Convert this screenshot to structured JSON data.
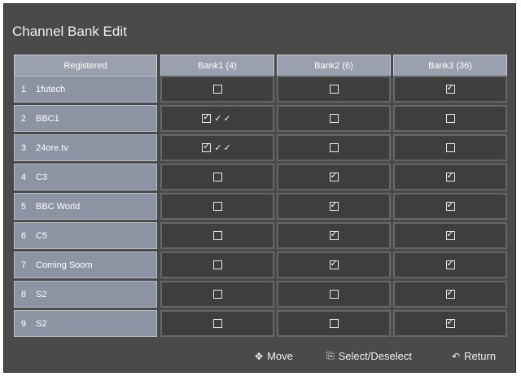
{
  "title": "Channel Bank Edit",
  "headers": {
    "registered": "Registered",
    "bank1": "Bank1 (4)",
    "bank2": "Bank2 (6)",
    "bank3": "Bank3 (36)"
  },
  "rows": [
    {
      "num": "1",
      "name": "1futech",
      "bank1": false,
      "bank2": false,
      "bank3": true,
      "marks": ""
    },
    {
      "num": "2",
      "name": "BBC1",
      "bank1": true,
      "bank2": false,
      "bank3": false,
      "marks": "✓✓"
    },
    {
      "num": "3",
      "name": "24ore.tv",
      "bank1": true,
      "bank2": false,
      "bank3": false,
      "marks": "✓✓"
    },
    {
      "num": "4",
      "name": "C3",
      "bank1": false,
      "bank2": true,
      "bank3": true,
      "marks": ""
    },
    {
      "num": "5",
      "name": "BBC World",
      "bank1": false,
      "bank2": true,
      "bank3": true,
      "marks": ""
    },
    {
      "num": "6",
      "name": "C5",
      "bank1": false,
      "bank2": true,
      "bank3": true,
      "marks": ""
    },
    {
      "num": "7",
      "name": "Coming Soom",
      "bank1": false,
      "bank2": true,
      "bank3": true,
      "marks": ""
    },
    {
      "num": "8",
      "name": "S2",
      "bank1": false,
      "bank2": false,
      "bank3": true,
      "marks": ""
    },
    {
      "num": "9",
      "name": "S2",
      "bank1": false,
      "bank2": false,
      "bank3": true,
      "marks": ""
    }
  ],
  "footer": {
    "move_label": "Move",
    "move_icon": "move-arrows-icon",
    "select_label": "Select/Deselect",
    "select_icon": "enter-icon",
    "return_label": "Return",
    "return_icon": "return-arrow-icon"
  }
}
